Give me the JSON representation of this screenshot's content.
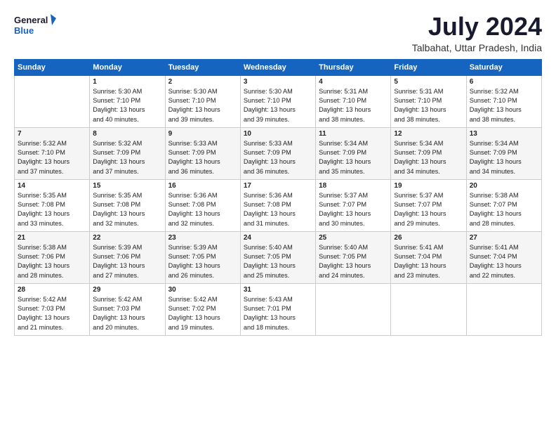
{
  "logo": {
    "line1": "General",
    "line2": "Blue"
  },
  "title": "July 2024",
  "subtitle": "Talbahat, Uttar Pradesh, India",
  "headers": [
    "Sunday",
    "Monday",
    "Tuesday",
    "Wednesday",
    "Thursday",
    "Friday",
    "Saturday"
  ],
  "rows": [
    [
      {
        "day": "",
        "lines": []
      },
      {
        "day": "1",
        "lines": [
          "Sunrise: 5:30 AM",
          "Sunset: 7:10 PM",
          "Daylight: 13 hours",
          "and 40 minutes."
        ]
      },
      {
        "day": "2",
        "lines": [
          "Sunrise: 5:30 AM",
          "Sunset: 7:10 PM",
          "Daylight: 13 hours",
          "and 39 minutes."
        ]
      },
      {
        "day": "3",
        "lines": [
          "Sunrise: 5:30 AM",
          "Sunset: 7:10 PM",
          "Daylight: 13 hours",
          "and 39 minutes."
        ]
      },
      {
        "day": "4",
        "lines": [
          "Sunrise: 5:31 AM",
          "Sunset: 7:10 PM",
          "Daylight: 13 hours",
          "and 38 minutes."
        ]
      },
      {
        "day": "5",
        "lines": [
          "Sunrise: 5:31 AM",
          "Sunset: 7:10 PM",
          "Daylight: 13 hours",
          "and 38 minutes."
        ]
      },
      {
        "day": "6",
        "lines": [
          "Sunrise: 5:32 AM",
          "Sunset: 7:10 PM",
          "Daylight: 13 hours",
          "and 38 minutes."
        ]
      }
    ],
    [
      {
        "day": "7",
        "lines": [
          "Sunrise: 5:32 AM",
          "Sunset: 7:10 PM",
          "Daylight: 13 hours",
          "and 37 minutes."
        ]
      },
      {
        "day": "8",
        "lines": [
          "Sunrise: 5:32 AM",
          "Sunset: 7:09 PM",
          "Daylight: 13 hours",
          "and 37 minutes."
        ]
      },
      {
        "day": "9",
        "lines": [
          "Sunrise: 5:33 AM",
          "Sunset: 7:09 PM",
          "Daylight: 13 hours",
          "and 36 minutes."
        ]
      },
      {
        "day": "10",
        "lines": [
          "Sunrise: 5:33 AM",
          "Sunset: 7:09 PM",
          "Daylight: 13 hours",
          "and 36 minutes."
        ]
      },
      {
        "day": "11",
        "lines": [
          "Sunrise: 5:34 AM",
          "Sunset: 7:09 PM",
          "Daylight: 13 hours",
          "and 35 minutes."
        ]
      },
      {
        "day": "12",
        "lines": [
          "Sunrise: 5:34 AM",
          "Sunset: 7:09 PM",
          "Daylight: 13 hours",
          "and 34 minutes."
        ]
      },
      {
        "day": "13",
        "lines": [
          "Sunrise: 5:34 AM",
          "Sunset: 7:09 PM",
          "Daylight: 13 hours",
          "and 34 minutes."
        ]
      }
    ],
    [
      {
        "day": "14",
        "lines": [
          "Sunrise: 5:35 AM",
          "Sunset: 7:08 PM",
          "Daylight: 13 hours",
          "and 33 minutes."
        ]
      },
      {
        "day": "15",
        "lines": [
          "Sunrise: 5:35 AM",
          "Sunset: 7:08 PM",
          "Daylight: 13 hours",
          "and 32 minutes."
        ]
      },
      {
        "day": "16",
        "lines": [
          "Sunrise: 5:36 AM",
          "Sunset: 7:08 PM",
          "Daylight: 13 hours",
          "and 32 minutes."
        ]
      },
      {
        "day": "17",
        "lines": [
          "Sunrise: 5:36 AM",
          "Sunset: 7:08 PM",
          "Daylight: 13 hours",
          "and 31 minutes."
        ]
      },
      {
        "day": "18",
        "lines": [
          "Sunrise: 5:37 AM",
          "Sunset: 7:07 PM",
          "Daylight: 13 hours",
          "and 30 minutes."
        ]
      },
      {
        "day": "19",
        "lines": [
          "Sunrise: 5:37 AM",
          "Sunset: 7:07 PM",
          "Daylight: 13 hours",
          "and 29 minutes."
        ]
      },
      {
        "day": "20",
        "lines": [
          "Sunrise: 5:38 AM",
          "Sunset: 7:07 PM",
          "Daylight: 13 hours",
          "and 28 minutes."
        ]
      }
    ],
    [
      {
        "day": "21",
        "lines": [
          "Sunrise: 5:38 AM",
          "Sunset: 7:06 PM",
          "Daylight: 13 hours",
          "and 28 minutes."
        ]
      },
      {
        "day": "22",
        "lines": [
          "Sunrise: 5:39 AM",
          "Sunset: 7:06 PM",
          "Daylight: 13 hours",
          "and 27 minutes."
        ]
      },
      {
        "day": "23",
        "lines": [
          "Sunrise: 5:39 AM",
          "Sunset: 7:05 PM",
          "Daylight: 13 hours",
          "and 26 minutes."
        ]
      },
      {
        "day": "24",
        "lines": [
          "Sunrise: 5:40 AM",
          "Sunset: 7:05 PM",
          "Daylight: 13 hours",
          "and 25 minutes."
        ]
      },
      {
        "day": "25",
        "lines": [
          "Sunrise: 5:40 AM",
          "Sunset: 7:05 PM",
          "Daylight: 13 hours",
          "and 24 minutes."
        ]
      },
      {
        "day": "26",
        "lines": [
          "Sunrise: 5:41 AM",
          "Sunset: 7:04 PM",
          "Daylight: 13 hours",
          "and 23 minutes."
        ]
      },
      {
        "day": "27",
        "lines": [
          "Sunrise: 5:41 AM",
          "Sunset: 7:04 PM",
          "Daylight: 13 hours",
          "and 22 minutes."
        ]
      }
    ],
    [
      {
        "day": "28",
        "lines": [
          "Sunrise: 5:42 AM",
          "Sunset: 7:03 PM",
          "Daylight: 13 hours",
          "and 21 minutes."
        ]
      },
      {
        "day": "29",
        "lines": [
          "Sunrise: 5:42 AM",
          "Sunset: 7:03 PM",
          "Daylight: 13 hours",
          "and 20 minutes."
        ]
      },
      {
        "day": "30",
        "lines": [
          "Sunrise: 5:42 AM",
          "Sunset: 7:02 PM",
          "Daylight: 13 hours",
          "and 19 minutes."
        ]
      },
      {
        "day": "31",
        "lines": [
          "Sunrise: 5:43 AM",
          "Sunset: 7:01 PM",
          "Daylight: 13 hours",
          "and 18 minutes."
        ]
      },
      {
        "day": "",
        "lines": []
      },
      {
        "day": "",
        "lines": []
      },
      {
        "day": "",
        "lines": []
      }
    ]
  ]
}
